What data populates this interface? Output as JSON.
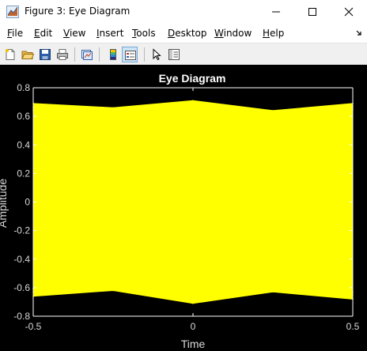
{
  "window": {
    "title": "Figure 3: Eye Diagram",
    "minimize_icon": "minimize-icon",
    "maximize_icon": "maximize-icon",
    "close_icon": "close-icon"
  },
  "menubar": {
    "items": [
      {
        "label": "File"
      },
      {
        "label": "Edit"
      },
      {
        "label": "View"
      },
      {
        "label": "Insert"
      },
      {
        "label": "Tools"
      },
      {
        "label": "Desktop"
      },
      {
        "label": "Window"
      },
      {
        "label": "Help"
      }
    ],
    "overflow_icon": "menu-overflow-arrow-icon"
  },
  "toolbar": {
    "buttons": [
      {
        "icon": "new-figure-icon"
      },
      {
        "icon": "open-file-icon"
      },
      {
        "icon": "save-icon"
      },
      {
        "icon": "print-icon"
      },
      {
        "icon": "link-plot-icon"
      },
      {
        "icon": "insert-colorbar-icon"
      },
      {
        "icon": "insert-legend-icon"
      },
      {
        "icon": "edit-plot-pointer-icon"
      },
      {
        "icon": "property-inspector-icon"
      }
    ]
  },
  "colors": {
    "figure_background": "#000000",
    "trace": "#ffff00",
    "axis": "#ffffff",
    "tick_label": "#d9d9d9"
  },
  "chart_data": {
    "type": "line",
    "title": "Eye Diagram",
    "xlabel": "Time",
    "ylabel": "Amplitude",
    "xlim": [
      -0.5,
      0.5
    ],
    "ylim": [
      -0.8,
      0.8
    ],
    "xticks": [
      -0.5,
      0,
      0.5
    ],
    "yticks": [
      0.8,
      0.6,
      0.4,
      0.2,
      0,
      -0.2,
      -0.4,
      -0.6,
      -0.8
    ],
    "xtick_labels": [
      "-0.5",
      "0",
      "0.5"
    ],
    "ytick_labels": [
      "0.8",
      "0.6",
      "0.4",
      "0.2",
      "0",
      "-0.2",
      "-0.4",
      "-0.6",
      "-0.8"
    ],
    "grid": false,
    "series": [
      {
        "x": [
          -0.5,
          -0.25,
          0,
          0.25,
          0.5
        ],
        "values": [
          0.69,
          0.66,
          0.71,
          0.64,
          0.69
        ]
      },
      {
        "x": [
          -0.5,
          -0.25,
          0,
          0.25,
          0.5
        ],
        "values": [
          0.66,
          0.63,
          0.68,
          0.62,
          0.67
        ]
      },
      {
        "x": [
          -0.5,
          -0.25,
          0,
          0.25,
          0.5
        ],
        "values": [
          0.64,
          0.62,
          0.66,
          0.61,
          0.65
        ]
      },
      {
        "x": [
          -0.5,
          -0.25,
          0,
          0.25,
          0.5
        ],
        "values": [
          -0.66,
          -0.62,
          -0.71,
          -0.63,
          -0.68
        ]
      },
      {
        "x": [
          -0.5,
          -0.25,
          0,
          0.25,
          0.5
        ],
        "values": [
          -0.63,
          -0.61,
          -0.67,
          -0.61,
          -0.65
        ]
      },
      {
        "x": [
          -0.5,
          -0.25,
          0,
          0.25,
          0.5
        ],
        "values": [
          -0.61,
          -0.6,
          -0.64,
          -0.6,
          -0.63
        ]
      }
    ]
  }
}
